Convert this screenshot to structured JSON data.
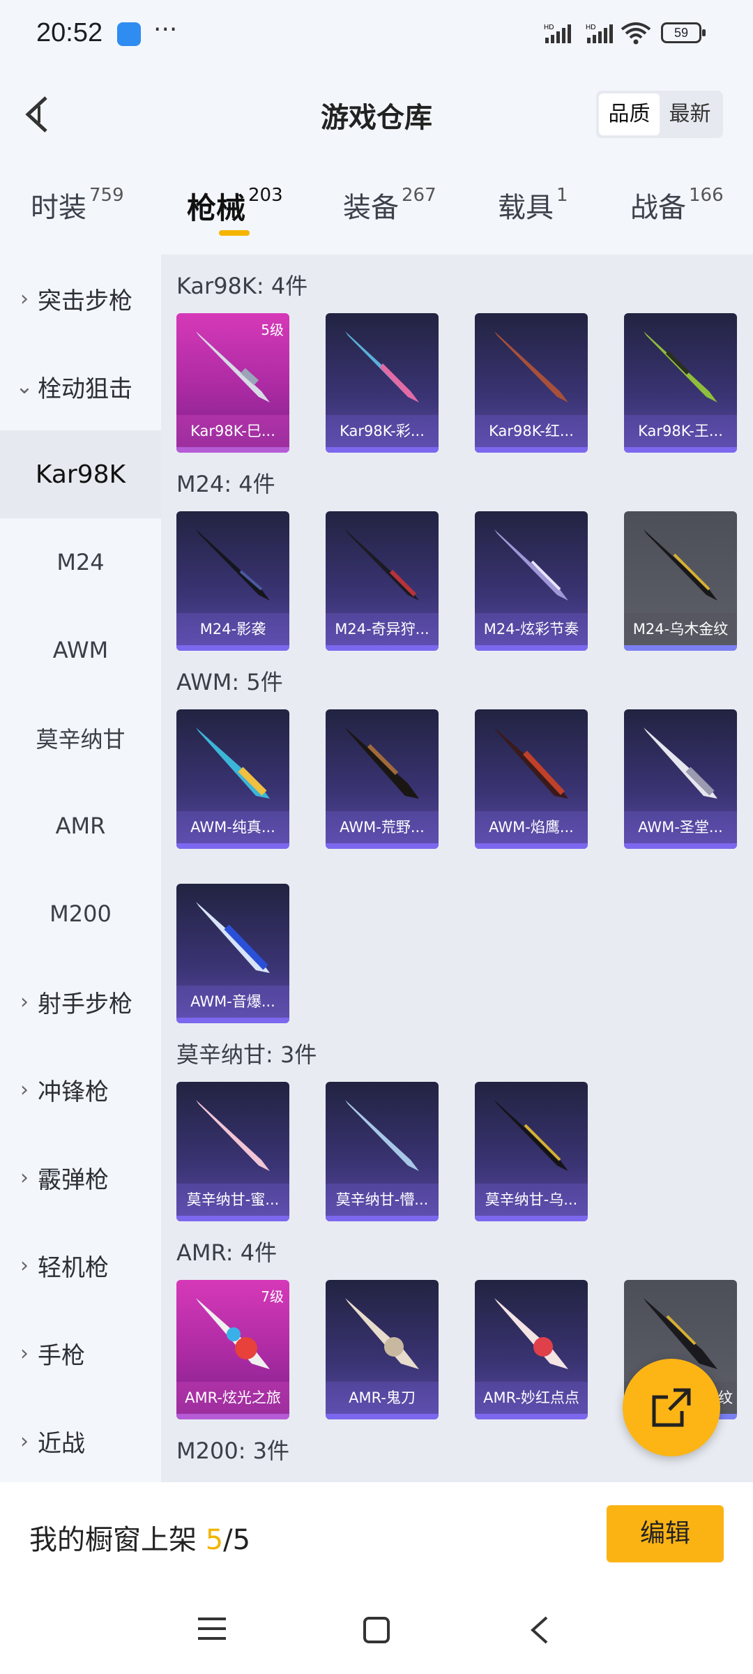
{
  "status": {
    "time": "20:52",
    "battery": "59"
  },
  "header": {
    "title": "游戏仓库",
    "sort_quality": "品质",
    "sort_latest": "最新"
  },
  "tabs": [
    {
      "label": "时装",
      "count": "759"
    },
    {
      "label": "枪械",
      "count": "203"
    },
    {
      "label": "装备",
      "count": "267"
    },
    {
      "label": "载具",
      "count": "1"
    },
    {
      "label": "战备",
      "count": "166"
    }
  ],
  "sidebar": [
    {
      "label": "突击步枪"
    },
    {
      "label": "栓动狙击"
    },
    {
      "label": "Kar98K"
    },
    {
      "label": "M24"
    },
    {
      "label": "AWM"
    },
    {
      "label": "莫辛纳甘"
    },
    {
      "label": "AMR"
    },
    {
      "label": "M200"
    },
    {
      "label": "射手步枪"
    },
    {
      "label": "冲锋枪"
    },
    {
      "label": "霰弹枪"
    },
    {
      "label": "轻机枪"
    },
    {
      "label": "手枪"
    },
    {
      "label": "近战"
    }
  ],
  "sections": [
    {
      "title": "Kar98K: 4件",
      "items": [
        {
          "name": "Kar98K-巳...",
          "level": "5级",
          "tier": "gold"
        },
        {
          "name": "Kar98K-彩...",
          "tier": "purple"
        },
        {
          "name": "Kar98K-红...",
          "tier": "purple"
        },
        {
          "name": "Kar98K-王...",
          "tier": "purple"
        }
      ]
    },
    {
      "title": "M24: 4件",
      "items": [
        {
          "name": "M24-影袭",
          "tier": "purple"
        },
        {
          "name": "M24-奇异狩...",
          "tier": "purple"
        },
        {
          "name": "M24-炫彩节奏",
          "tier": "purple"
        },
        {
          "name": "M24-乌木金纹",
          "tier": "gray"
        }
      ]
    },
    {
      "title": "AWM: 5件",
      "items": [
        {
          "name": "AWM-纯真...",
          "tier": "purple"
        },
        {
          "name": "AWM-荒野...",
          "tier": "purple"
        },
        {
          "name": "AWM-焰鹰...",
          "tier": "purple"
        },
        {
          "name": "AWM-圣堂...",
          "tier": "purple"
        },
        {
          "name": "AWM-音爆...",
          "tier": "purple"
        }
      ]
    },
    {
      "title": "莫辛纳甘: 3件",
      "items": [
        {
          "name": "莫辛纳甘-蜜...",
          "tier": "purple"
        },
        {
          "name": "莫辛纳甘-懵...",
          "tier": "purple"
        },
        {
          "name": "莫辛纳甘-乌...",
          "tier": "purple"
        }
      ]
    },
    {
      "title": "AMR: 4件",
      "items": [
        {
          "name": "AMR-炫光之旅",
          "level": "7级",
          "tier": "gold"
        },
        {
          "name": "AMR-鬼刀",
          "tier": "purple"
        },
        {
          "name": "AMR-妙红点点",
          "tier": "purple"
        },
        {
          "name": "纹",
          "tier": "gray"
        }
      ]
    },
    {
      "title": "M200: 3件",
      "items": []
    }
  ],
  "bottom": {
    "shelf_label": "我的橱窗上架",
    "shelf_used": "5",
    "shelf_total": "/5",
    "edit_label": "编辑"
  },
  "colors": {
    "accent": "#fbb314",
    "tab_underline": "#f5b400",
    "purple_card": "#3a3474",
    "gold_card": "#d639b8"
  }
}
